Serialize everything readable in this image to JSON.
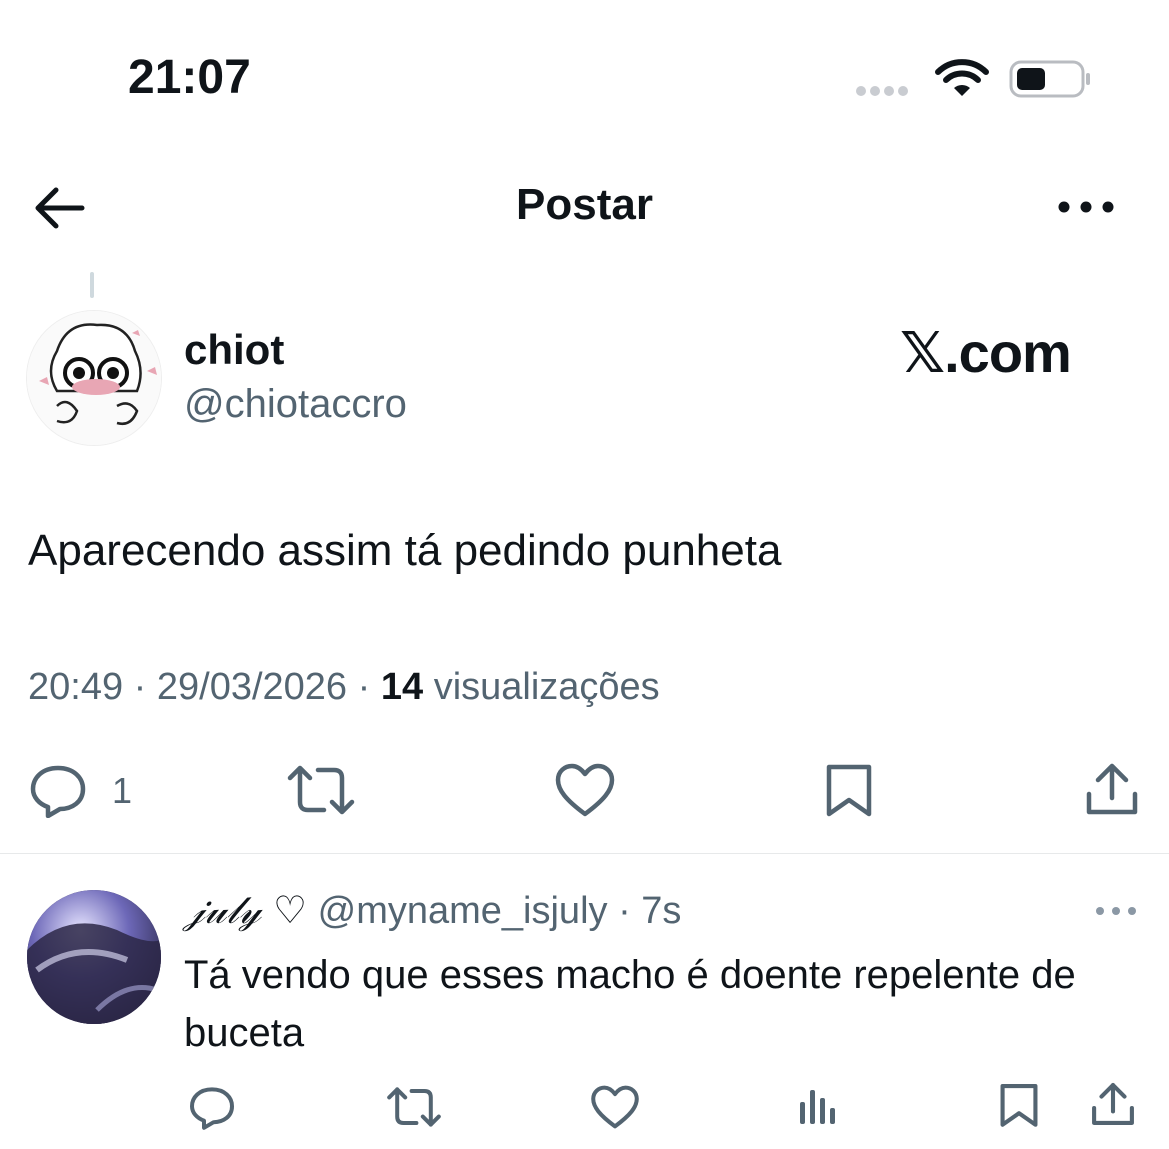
{
  "status_bar": {
    "time": "21:07"
  },
  "nav": {
    "title": "Postar"
  },
  "post": {
    "display_name": "chiot",
    "handle": "@chiotaccro",
    "watermark": "𝕏.com",
    "text": "Aparecendo assim tá pedindo punheta",
    "time": "20:49",
    "date": "29/03/2026",
    "views_count": "14",
    "views_label": "visualizações",
    "reply_count": "1"
  },
  "reply": {
    "display_name": "𝒿𝓊𝓁𝓎 ♡",
    "handle": "@myname_isjuly",
    "age": "7s",
    "text": "Tá vendo que esses macho é doente repelente de buceta"
  },
  "colors": {
    "text": "#0f1419",
    "muted": "#536471",
    "divider": "#e7e9ea"
  },
  "icons": [
    "back-arrow-icon",
    "more-icon",
    "reply-icon",
    "repost-icon",
    "like-icon",
    "bookmark-icon",
    "share-icon",
    "views-icon",
    "wifi-icon",
    "battery-icon"
  ]
}
